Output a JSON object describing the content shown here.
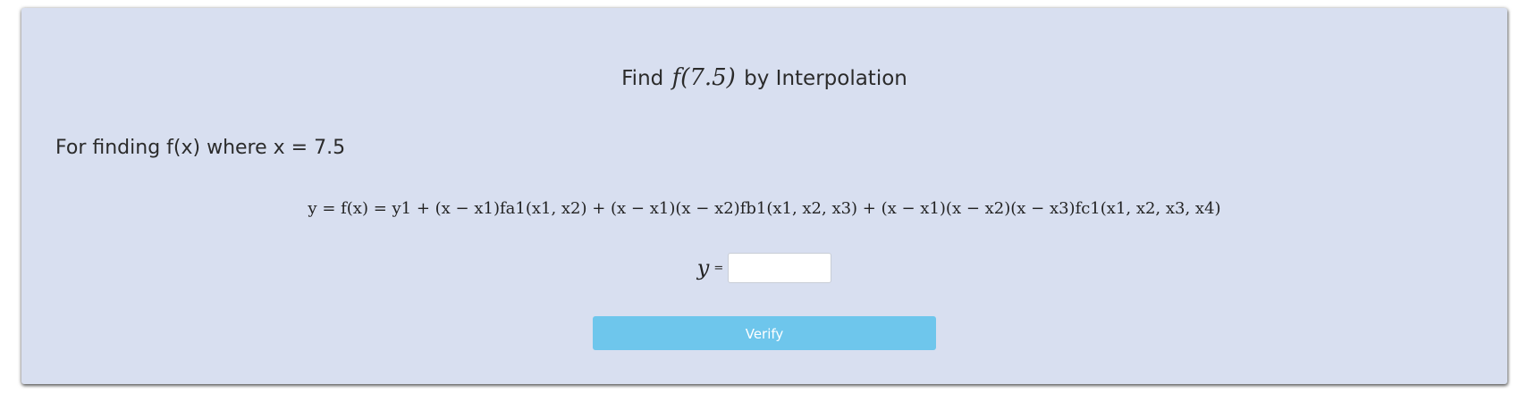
{
  "question": {
    "title_prefix": "Find",
    "title_math": "f(7.5)",
    "title_suffix": "by Interpolation",
    "prompt": "For finding f(x) where x = 7.5"
  },
  "formula": {
    "text": "y = f(x) = y1 + (x − x1)fa1(x1, x2) + (x − x1)(x − x2)fb1(x1, x2, x3) + (x − x1)(x − x2)(x − x3)fc1(x1, x2, x3, x4)"
  },
  "answer": {
    "variable": "y",
    "equals": "=",
    "value": "",
    "placeholder": ""
  },
  "actions": {
    "verify_label": "Verify"
  },
  "colors": {
    "card_background": "#d8dff0",
    "button_background": "#6ec6ec",
    "button_text": "#ffffff"
  }
}
